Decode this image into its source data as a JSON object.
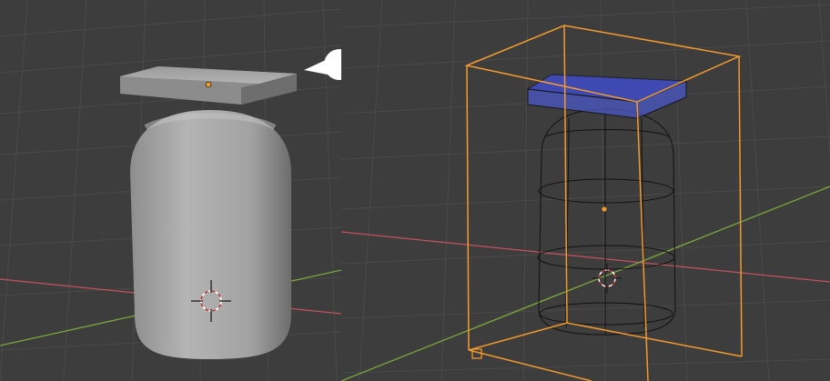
{
  "scene": {
    "background": "#3d3d3d",
    "grid_color": "#4a4a4a",
    "x_axis_color": "#c45260",
    "y_axis_color": "#7ba83a",
    "selection_outline_color": "#f29a2e",
    "face_select_color": "#4b58c7",
    "wire_color": "#111111"
  },
  "left_viewport": {
    "mode": "solid",
    "objects": [
      "lid-slab",
      "capsule-body",
      "speech-bubble"
    ]
  },
  "right_viewport": {
    "mode": "wireframe",
    "objects": [
      "bounding-box",
      "lid-slab",
      "capsule-wireframe"
    ]
  }
}
